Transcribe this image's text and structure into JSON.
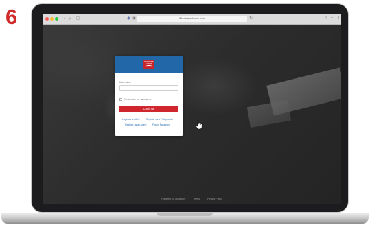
{
  "step_number": "6",
  "browser": {
    "url": "fl.builderschoice.com"
  },
  "login": {
    "logo_text": "BUILDERS CHOICE",
    "username_label": "Username",
    "username_value": "",
    "remember_label": "Remember my username",
    "remember_checked": false,
    "continue_label": "Continue",
    "link_login_mls": "Login as an MLS",
    "link_register_policyholder": "Register as a Policyholder",
    "link_register_agent": "Register as an Agent",
    "link_forgot_password": "Forgot Password"
  },
  "footer": {
    "powered_by": "Powered by Guidewire",
    "terms": "Terms",
    "privacy": "Privacy Policy"
  },
  "colors": {
    "step_number": "#d12a2a",
    "header_blue": "#2268a9",
    "button_red": "#d0272f",
    "link_blue": "#2a6fb3"
  }
}
